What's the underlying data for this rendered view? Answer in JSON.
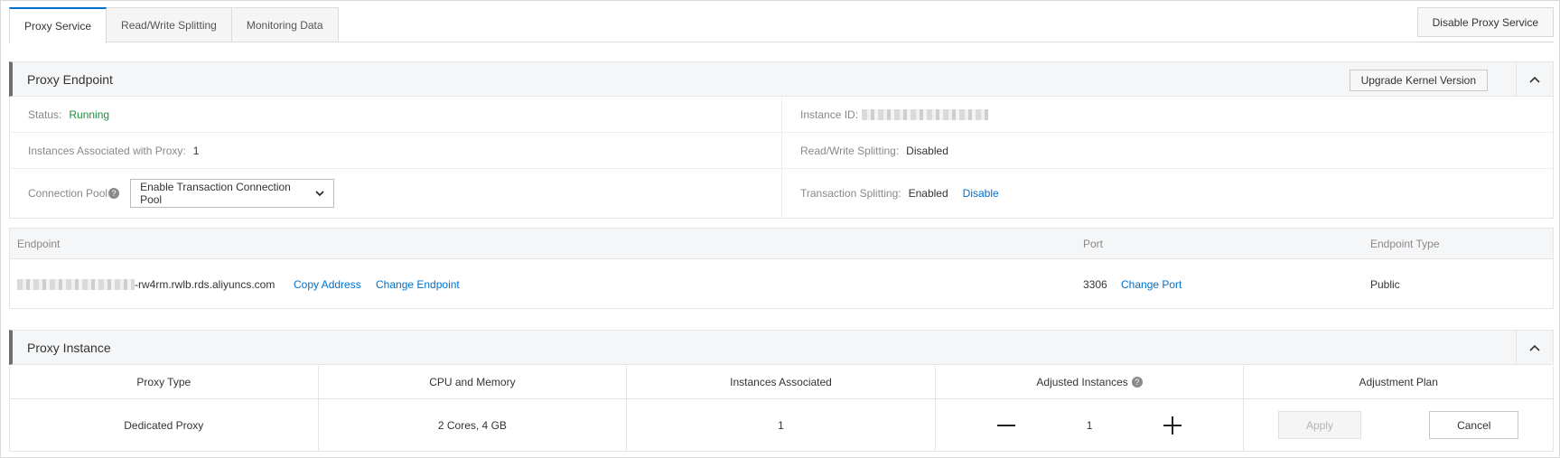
{
  "tabs": [
    {
      "label": "Proxy Service",
      "active": true
    },
    {
      "label": "Read/Write Splitting",
      "active": false
    },
    {
      "label": "Monitoring Data",
      "active": false
    }
  ],
  "disable_proxy_button": "Disable Proxy Service",
  "proxy_endpoint": {
    "title": "Proxy Endpoint",
    "upgrade_button": "Upgrade Kernel Version",
    "status_label": "Status:",
    "status_value": "Running",
    "instance_id_label": "Instance ID:",
    "instances_associated_label": "Instances Associated with Proxy:",
    "instances_associated_value": "1",
    "rw_splitting_label": "Read/Write Splitting:",
    "rw_splitting_value": "Disabled",
    "connection_pool_label": "Connection Pool",
    "connection_pool_value": "Enable Transaction Connection Pool",
    "transaction_splitting_label": "Transaction Splitting:",
    "transaction_splitting_value": "Enabled",
    "transaction_splitting_action": "Disable"
  },
  "endpoint_table": {
    "headers": {
      "endpoint": "Endpoint",
      "port": "Port",
      "type": "Endpoint Type"
    },
    "row": {
      "endpoint_suffix": "-rw4rm.rwlb.rds.aliyuncs.com",
      "copy_address": "Copy Address",
      "change_endpoint": "Change Endpoint",
      "port": "3306",
      "change_port": "Change Port",
      "type": "Public"
    }
  },
  "proxy_instance": {
    "title": "Proxy Instance",
    "headers": [
      "Proxy Type",
      "CPU and Memory",
      "Instances Associated",
      "Adjusted Instances",
      "Adjustment Plan"
    ],
    "row": {
      "proxy_type": "Dedicated Proxy",
      "cpu_memory": "2 Cores, 4 GB",
      "instances_associated": "1",
      "adjusted_instances": "1",
      "apply": "Apply",
      "cancel": "Cancel"
    }
  },
  "colors": {
    "accent": "#0070cc",
    "running": "#1e8e3e"
  }
}
